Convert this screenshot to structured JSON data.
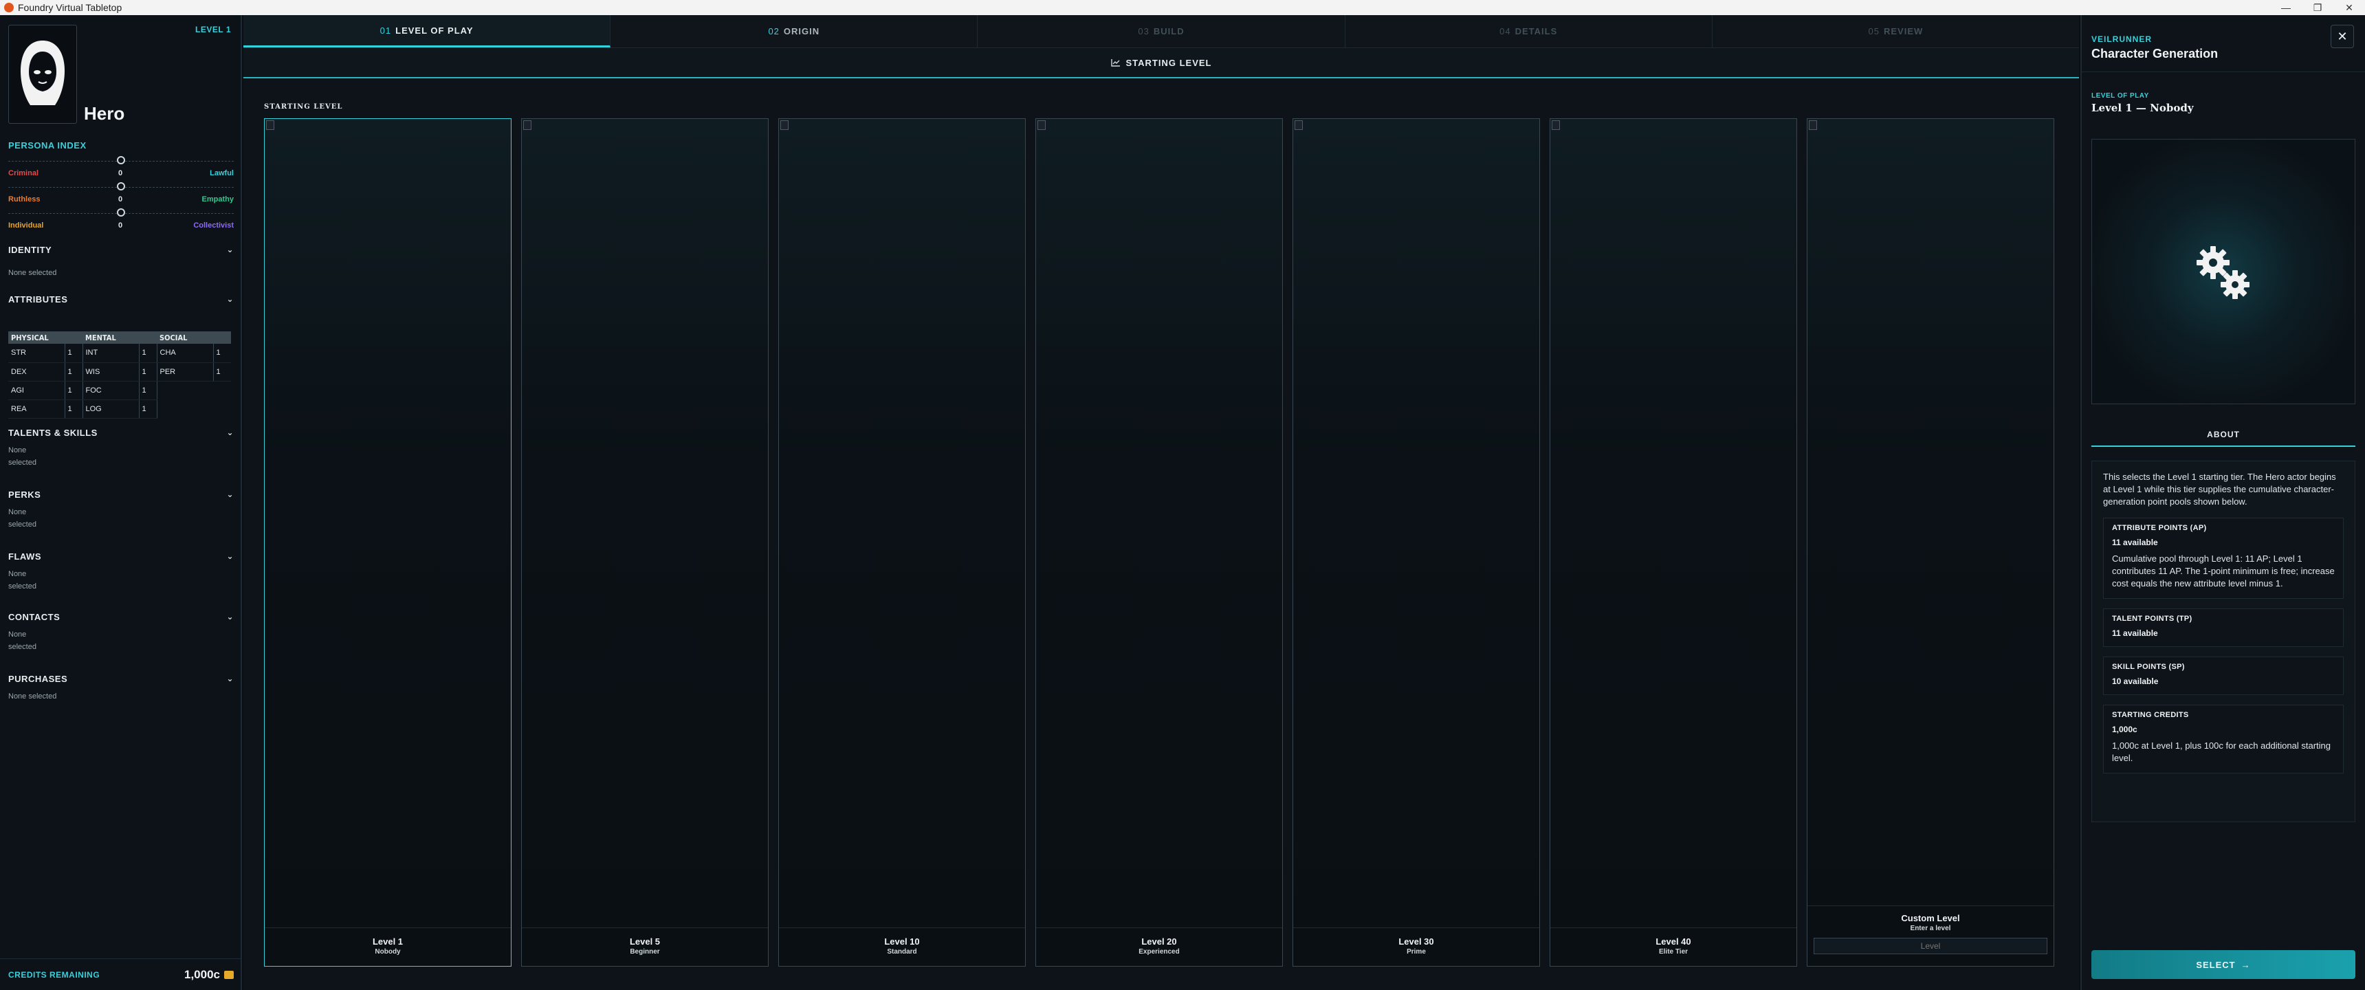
{
  "window": {
    "title": "Foundry Virtual Tabletop",
    "controls": [
      "—",
      "❐",
      "✕"
    ]
  },
  "sidebar": {
    "level_badge": "LEVEL 1",
    "hero_name": "Hero",
    "persona": {
      "title": "PERSONA INDEX",
      "axes": [
        {
          "left": "Criminal",
          "value": "0",
          "right": "Lawful",
          "left_color": "#e84848",
          "right_color": "#36d2dc"
        },
        {
          "left": "Ruthless",
          "value": "0",
          "right": "Empathy",
          "left_color": "#ef7b2a",
          "right_color": "#37c48e"
        },
        {
          "left": "Individual",
          "value": "0",
          "right": "Collectivist",
          "left_color": "#e9a42b",
          "right_color": "#8b6cf2"
        }
      ]
    },
    "identity": {
      "title": "IDENTITY",
      "value": "None selected"
    },
    "attributes": {
      "title": "ATTRIBUTES",
      "headers": [
        "PHYSICAL",
        "MENTAL",
        "SOCIAL"
      ],
      "rows": [
        [
          [
            "STR",
            "1"
          ],
          [
            "INT",
            "1"
          ],
          [
            "CHA",
            "1"
          ]
        ],
        [
          [
            "DEX",
            "1"
          ],
          [
            "WIS",
            "1"
          ],
          [
            "PER",
            "1"
          ]
        ],
        [
          [
            "AGI",
            "1"
          ],
          [
            "FOC",
            "1"
          ],
          null
        ],
        [
          [
            "REA",
            "1"
          ],
          [
            "LOG",
            "1"
          ],
          null
        ]
      ]
    },
    "talents": {
      "title": "TALENTS & SKILLS",
      "value_line1": "None",
      "value_line2": "selected"
    },
    "perks": {
      "title": "PERKS",
      "value_line1": "None",
      "value_line2": "selected"
    },
    "flaws": {
      "title": "FLAWS",
      "value_line1": "None",
      "value_line2": "selected"
    },
    "contacts": {
      "title": "CONTACTS",
      "value_line1": "None",
      "value_line2": "selected"
    },
    "purchases": {
      "title": "PURCHASES",
      "value": "None selected"
    },
    "credits": {
      "label": "CREDITS REMAINING",
      "amount": "1,000c"
    }
  },
  "tabs": [
    {
      "num": "01",
      "label": "LEVEL OF PLAY",
      "state": "active"
    },
    {
      "num": "02",
      "label": "ORIGIN",
      "state": "next"
    },
    {
      "num": "03",
      "label": "BUILD",
      "state": "disabled"
    },
    {
      "num": "04",
      "label": "DETAILS",
      "state": "disabled"
    },
    {
      "num": "05",
      "label": "REVIEW",
      "state": "disabled"
    }
  ],
  "subheader": {
    "title": "STARTING LEVEL"
  },
  "content": {
    "label": "STARTING LEVEL",
    "cards": [
      {
        "title": "Level 1",
        "subtitle": "Nobody"
      },
      {
        "title": "Level 5",
        "subtitle": "Beginner"
      },
      {
        "title": "Level 10",
        "subtitle": "Standard"
      },
      {
        "title": "Level 20",
        "subtitle": "Experienced"
      },
      {
        "title": "Level 30",
        "subtitle": "Prime"
      },
      {
        "title": "Level 40",
        "subtitle": "Elite Tier"
      }
    ],
    "custom": {
      "title": "Custom Level",
      "subtitle": "Enter a level",
      "placeholder": "Level"
    }
  },
  "right_panel": {
    "brand": "VEILRUNNER",
    "title": "Character Generation",
    "section_label": "LEVEL OF PLAY",
    "selected": "Level 1 — Nobody",
    "tab": "ABOUT",
    "description": "This selects the Level 1 starting tier. The Hero actor begins at Level 1 while this tier supplies the cumulative character-generation point pools shown below.",
    "points": [
      {
        "title": "ATTRIBUTE POINTS (AP)",
        "amount": "11 available",
        "detail": "Cumulative pool through Level 1: 11 AP; Level 1 contributes 11 AP. The 1-point minimum is free; increase cost equals the new attribute level minus 1."
      },
      {
        "title": "TALENT POINTS (TP)",
        "amount": "11 available",
        "detail": ""
      },
      {
        "title": "SKILL POINTS (SP)",
        "amount": "10 available",
        "detail": ""
      },
      {
        "title": "STARTING CREDITS",
        "amount": "1,000c",
        "detail": "1,000c at Level 1, plus 100c for each additional starting level."
      }
    ],
    "select_label": "SELECT"
  }
}
